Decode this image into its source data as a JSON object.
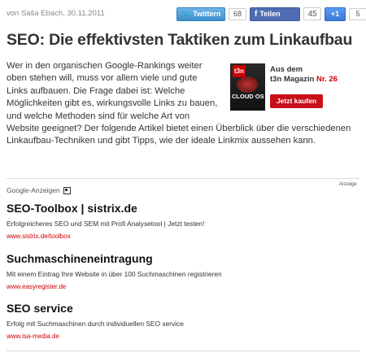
{
  "byline": "von Saša Ebach, 30.11.2011",
  "social": {
    "twitter_label": "Twittern",
    "twitter_count": "68",
    "facebook_label": "Teilen",
    "facebook_count": "45",
    "gplus_label": "+1",
    "gplus_count": "5"
  },
  "article": {
    "title": "SEO: Die effektivsten Taktiken zum Linkaufbau",
    "intro": "Wer in den organischen Google-Rankings weiter oben stehen will, muss vor allem viele und gute Links aufbauen. Die Frage dabei ist: Welche Möglichkeiten gibt es, wirkungsvolle Links zu bauen, und welche Methoden sind für welche Art von Website geeignet? Der folgende Artikel bietet einen Überblick über die verschiedenen Linkaufbau-Techniken und gibt Tipps, wie der ideale Linkmix aussehen kann."
  },
  "promo": {
    "cover_brand": "t3n",
    "cover_text": "CLOUD OS",
    "line1": "Aus dem",
    "magazine": "t3n Magazin",
    "issue": "Nr. 26",
    "button": "Jetzt kaufen"
  },
  "ads": {
    "label": "Google-Anzeigen",
    "tag": "Anzeige",
    "items": [
      {
        "title": "SEO-Toolbox | sistrix.de",
        "desc": "Erfolgreicheres SEO und SEM mit Profi Analysetool | Jetzt testen!",
        "url": "www.sistrix.de/toolbox"
      },
      {
        "title": "Suchmaschineneintragung",
        "desc": "Mit einem Eintrag Ihre Website in über 100 Suchmaschinen registrieren",
        "url": "www.easyregister.de"
      },
      {
        "title": "SEO service",
        "desc": "Erfolg mit Suchmaschinen durch individuellen SEO service",
        "url": "www.isa-media.de"
      }
    ]
  },
  "colors": {
    "accent_red": "#c8101a",
    "twitter": "#3b8fd0",
    "facebook": "#4e6db0",
    "gplus": "#3a78d8"
  }
}
